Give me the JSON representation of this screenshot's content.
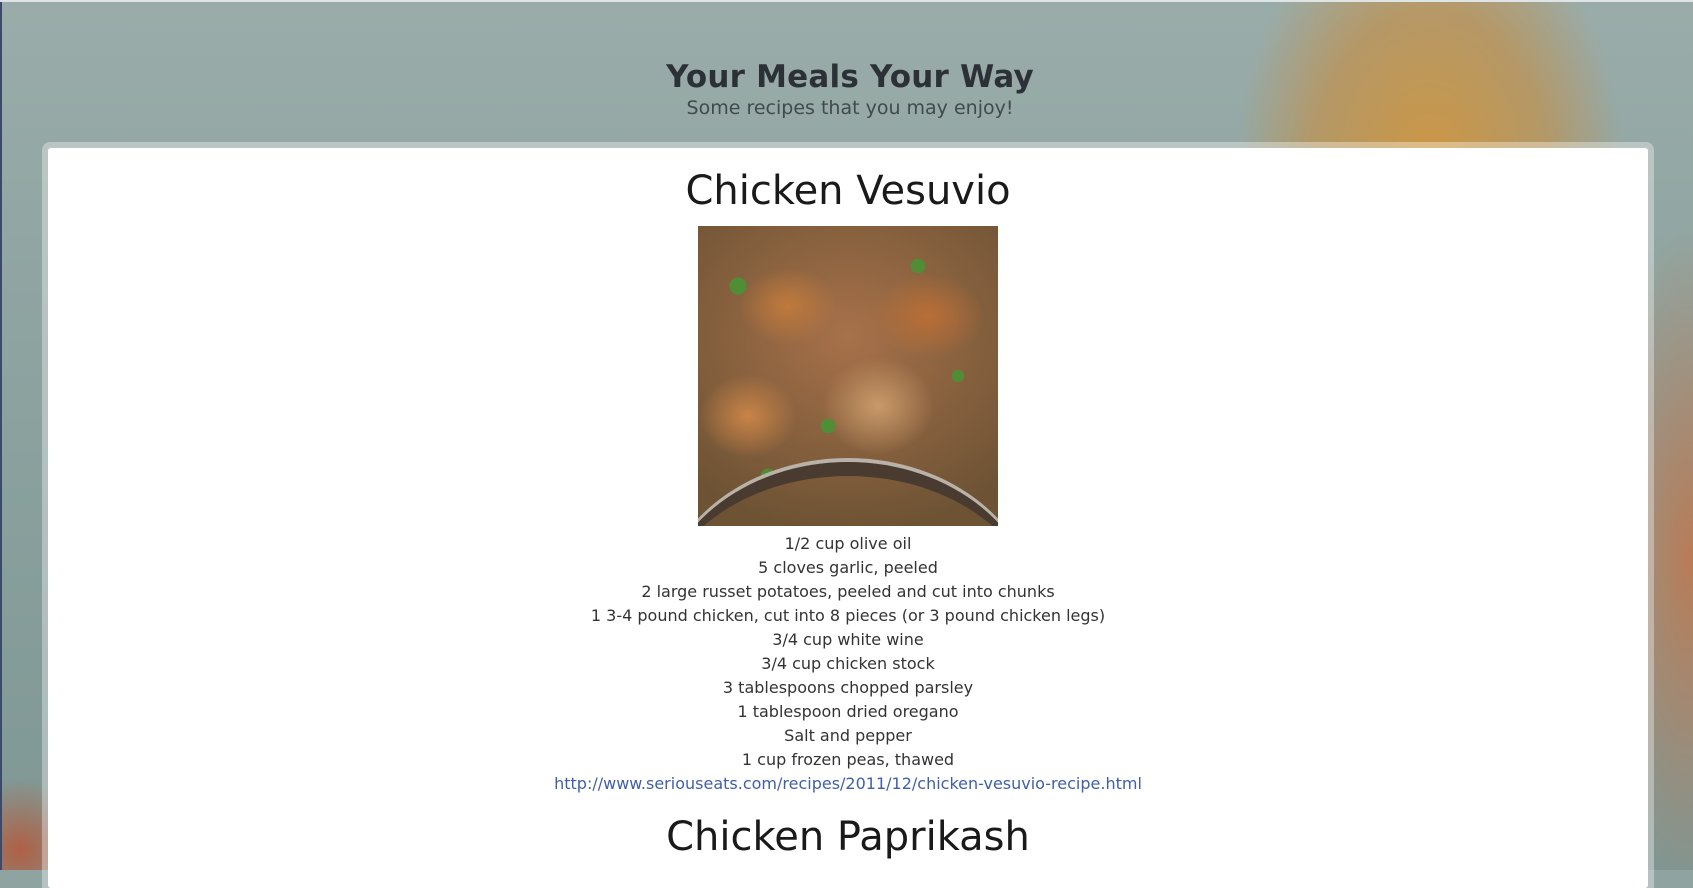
{
  "header": {
    "title": "Your Meals Your Way",
    "subtitle": "Some recipes that you may enjoy!"
  },
  "recipes": [
    {
      "title": "Chicken Vesuvio",
      "image_alt": "Chicken Vesuvio",
      "ingredients": [
        "1/2 cup olive oil",
        "5 cloves garlic, peeled",
        "2 large russet potatoes, peeled and cut into chunks",
        "1 3-4 pound chicken, cut into 8 pieces (or 3 pound chicken legs)",
        "3/4 cup white wine",
        "3/4 cup chicken stock",
        "3 tablespoons chopped parsley",
        "1 tablespoon dried oregano",
        "Salt and pepper",
        "1 cup frozen peas, thawed"
      ],
      "link": "http://www.seriouseats.com/recipes/2011/12/chicken-vesuvio-recipe.html"
    },
    {
      "title": "Chicken Paprikash"
    }
  ],
  "colors": {
    "link": "#3f5fa8",
    "card": "#ffffff",
    "title_text": "#2c3138"
  }
}
